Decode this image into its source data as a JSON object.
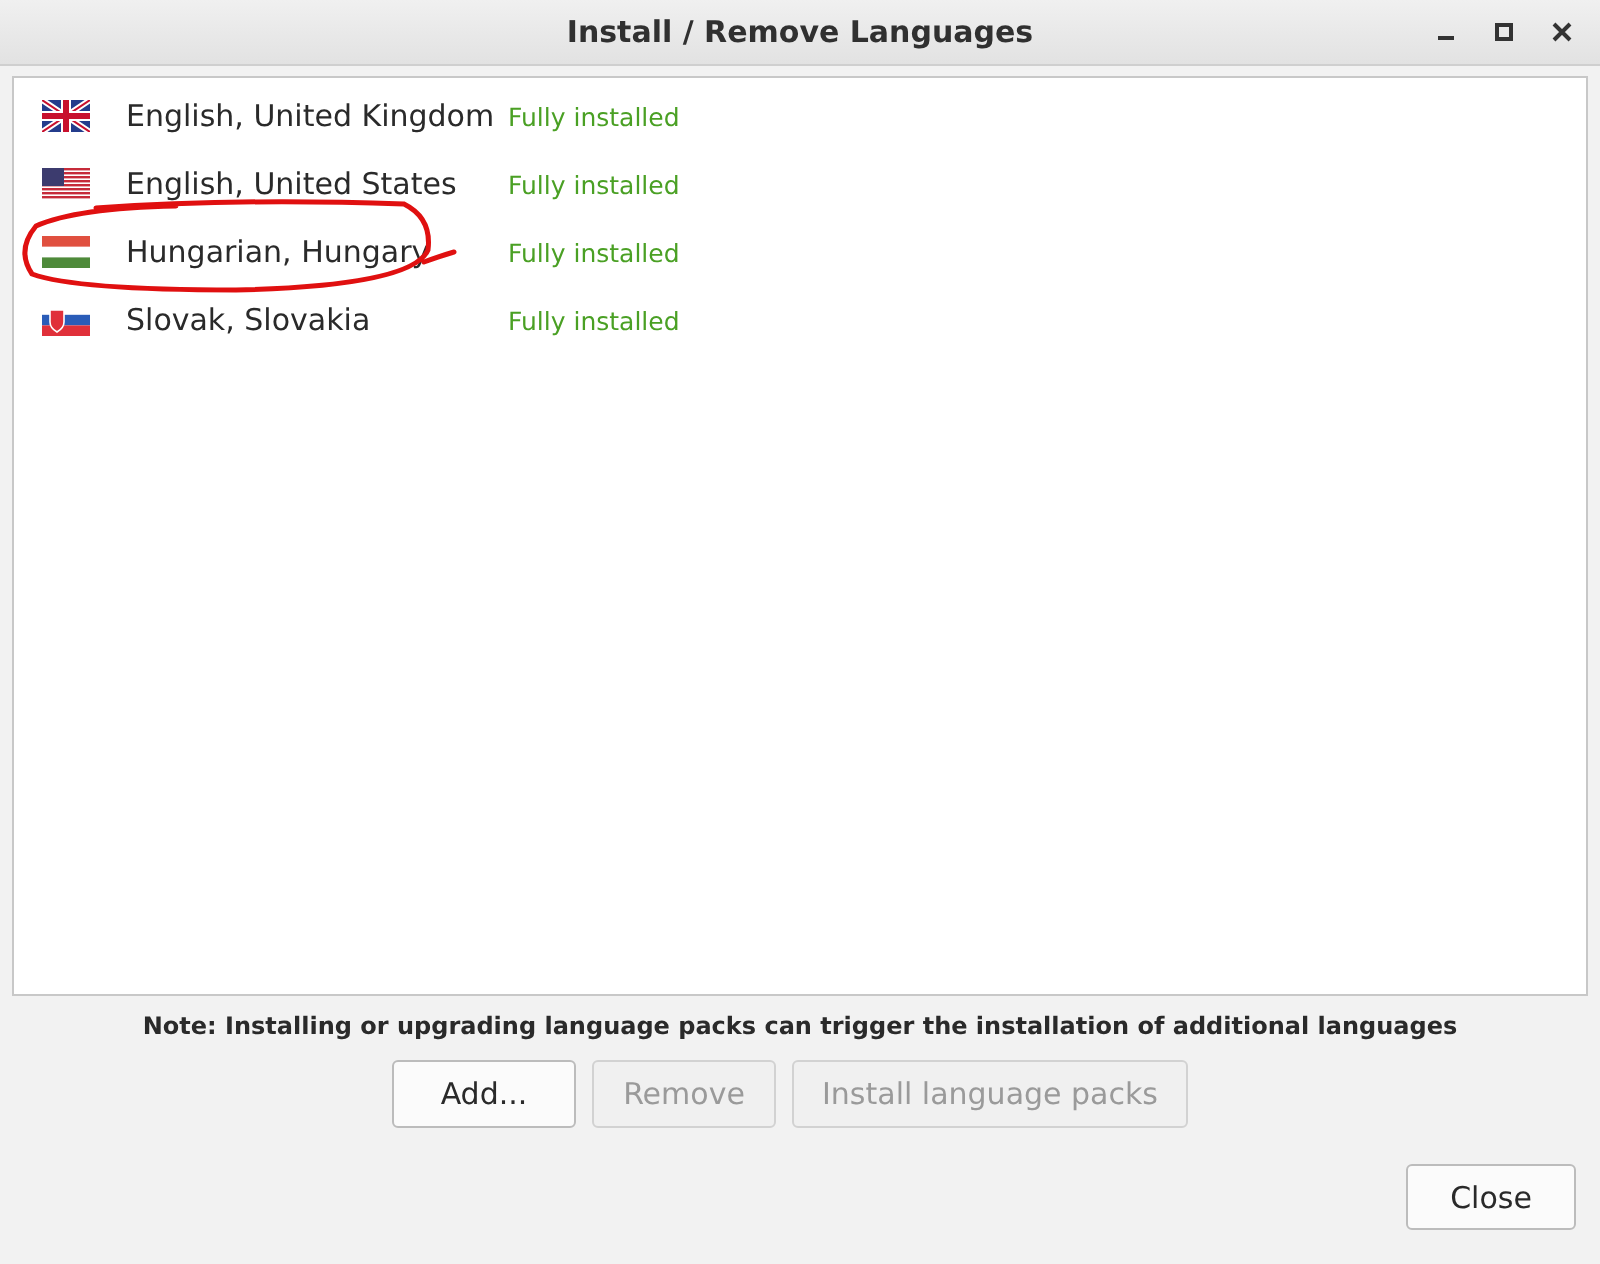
{
  "window": {
    "title": "Install / Remove Languages"
  },
  "languages": [
    {
      "name": "English, United Kingdom",
      "status": "Fully installed"
    },
    {
      "name": "English, United States",
      "status": "Fully installed"
    },
    {
      "name": "Hungarian, Hungary",
      "status": "Fully installed"
    },
    {
      "name": "Slovak, Slovakia",
      "status": "Fully installed"
    }
  ],
  "note": "Note: Installing or upgrading language packs can trigger the installation of additional languages",
  "buttons": [
    {
      "label": "Add...",
      "disabled": false
    },
    {
      "label": "Remove",
      "disabled": true
    },
    {
      "label": "Install language packs",
      "disabled": true
    }
  ],
  "close_button": "Close"
}
